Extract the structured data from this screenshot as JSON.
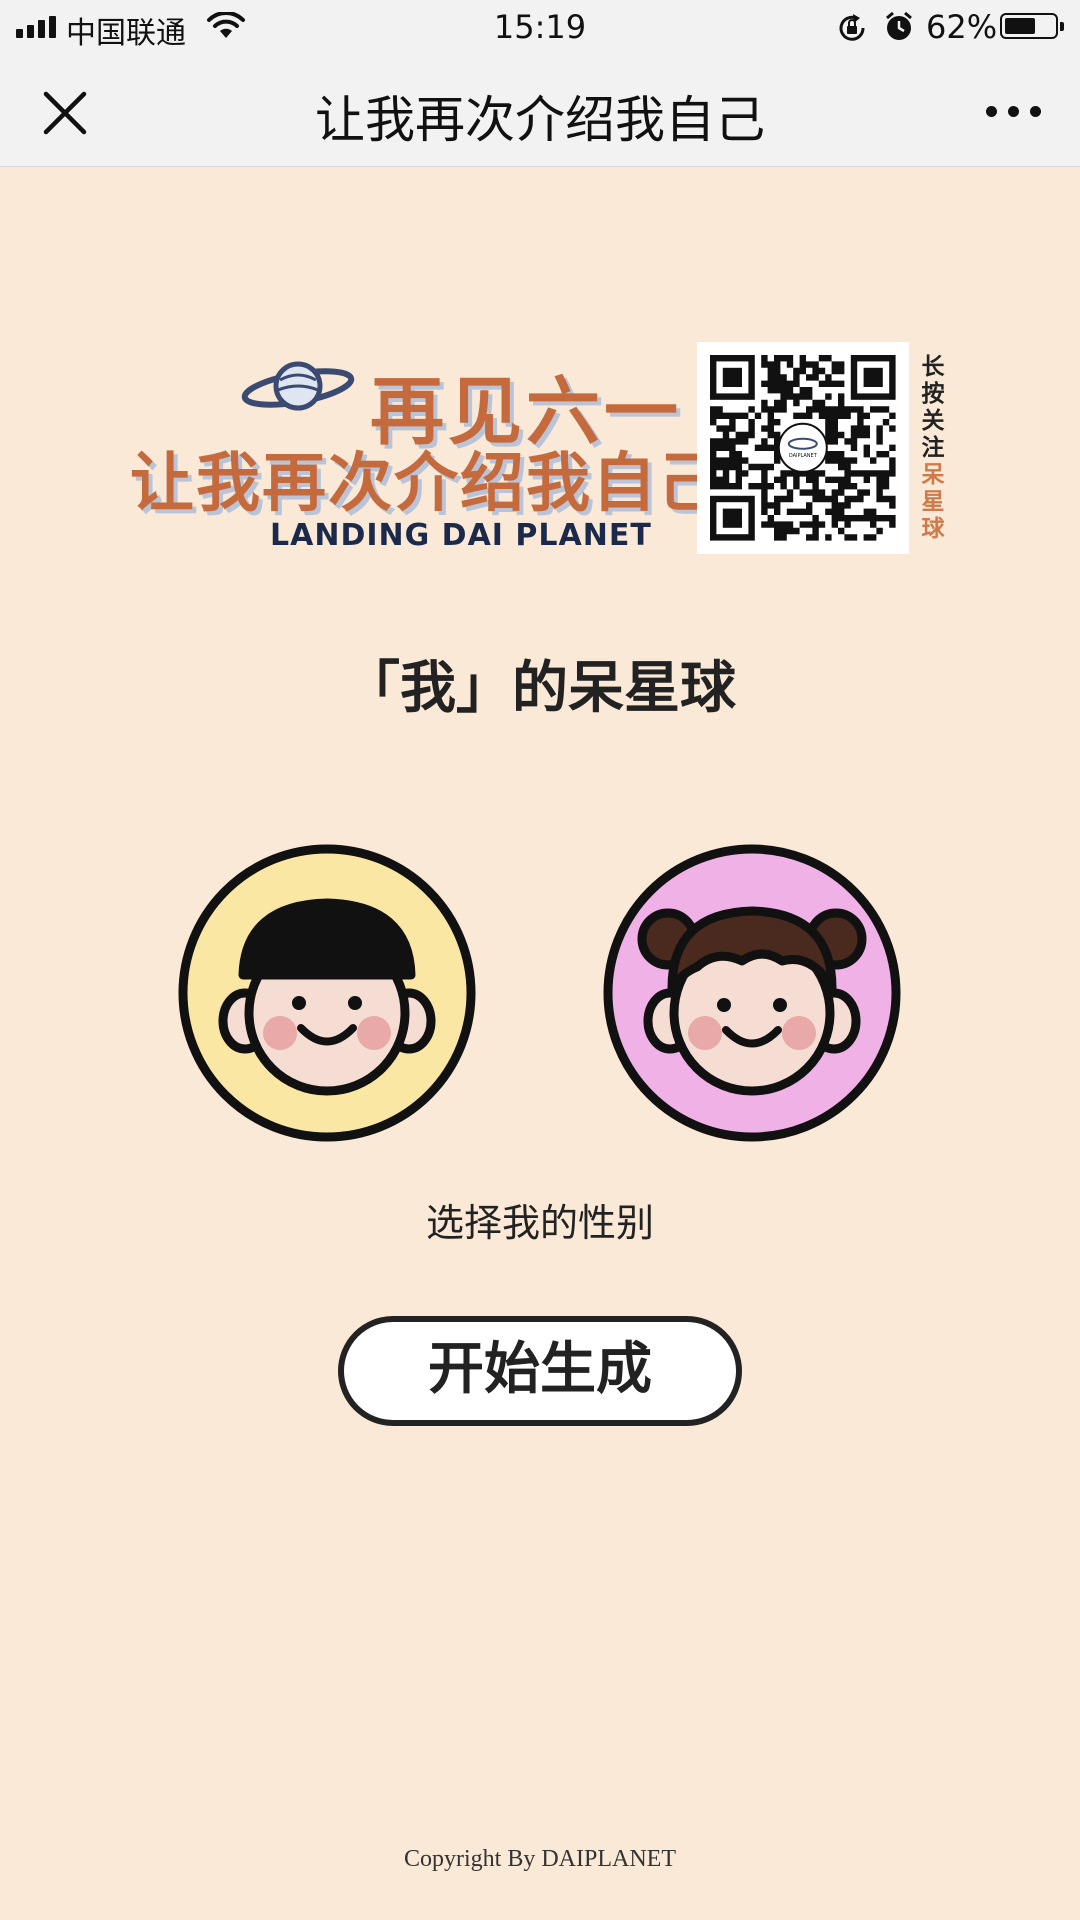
{
  "status_bar": {
    "carrier": "中国联通",
    "time": "15:19",
    "battery_percent": "62%",
    "battery_level": 0.62,
    "icons": [
      "signal-icon",
      "wifi-icon",
      "rotation-lock-icon",
      "alarm-icon",
      "battery-icon"
    ]
  },
  "nav": {
    "title": "让我再次介绍我自己",
    "close_icon": "close-icon",
    "more_icon": "more-icon"
  },
  "banner": {
    "line1": "再见六一",
    "line2": "让我再次介绍我自己",
    "subtitle": "LANDING DAI PLANET",
    "qr_caption_dark": "长按关注",
    "qr_caption_accent": "呆星球",
    "qr_center_text": "DAIPLANET",
    "accent_color": "#c56a3d"
  },
  "main": {
    "heading": "「我」的呆星球",
    "avatars": [
      {
        "name": "boy",
        "bg_color": "#fbe7a4"
      },
      {
        "name": "girl",
        "bg_color": "#efb1e6"
      }
    ],
    "gender_label": "选择我的性别",
    "start_button": "开始生成"
  },
  "footer": {
    "copyright": "Copyright By DAIPLANET"
  },
  "colors": {
    "background": "#f9e9d6",
    "bar_background": "#f2f2f2"
  }
}
